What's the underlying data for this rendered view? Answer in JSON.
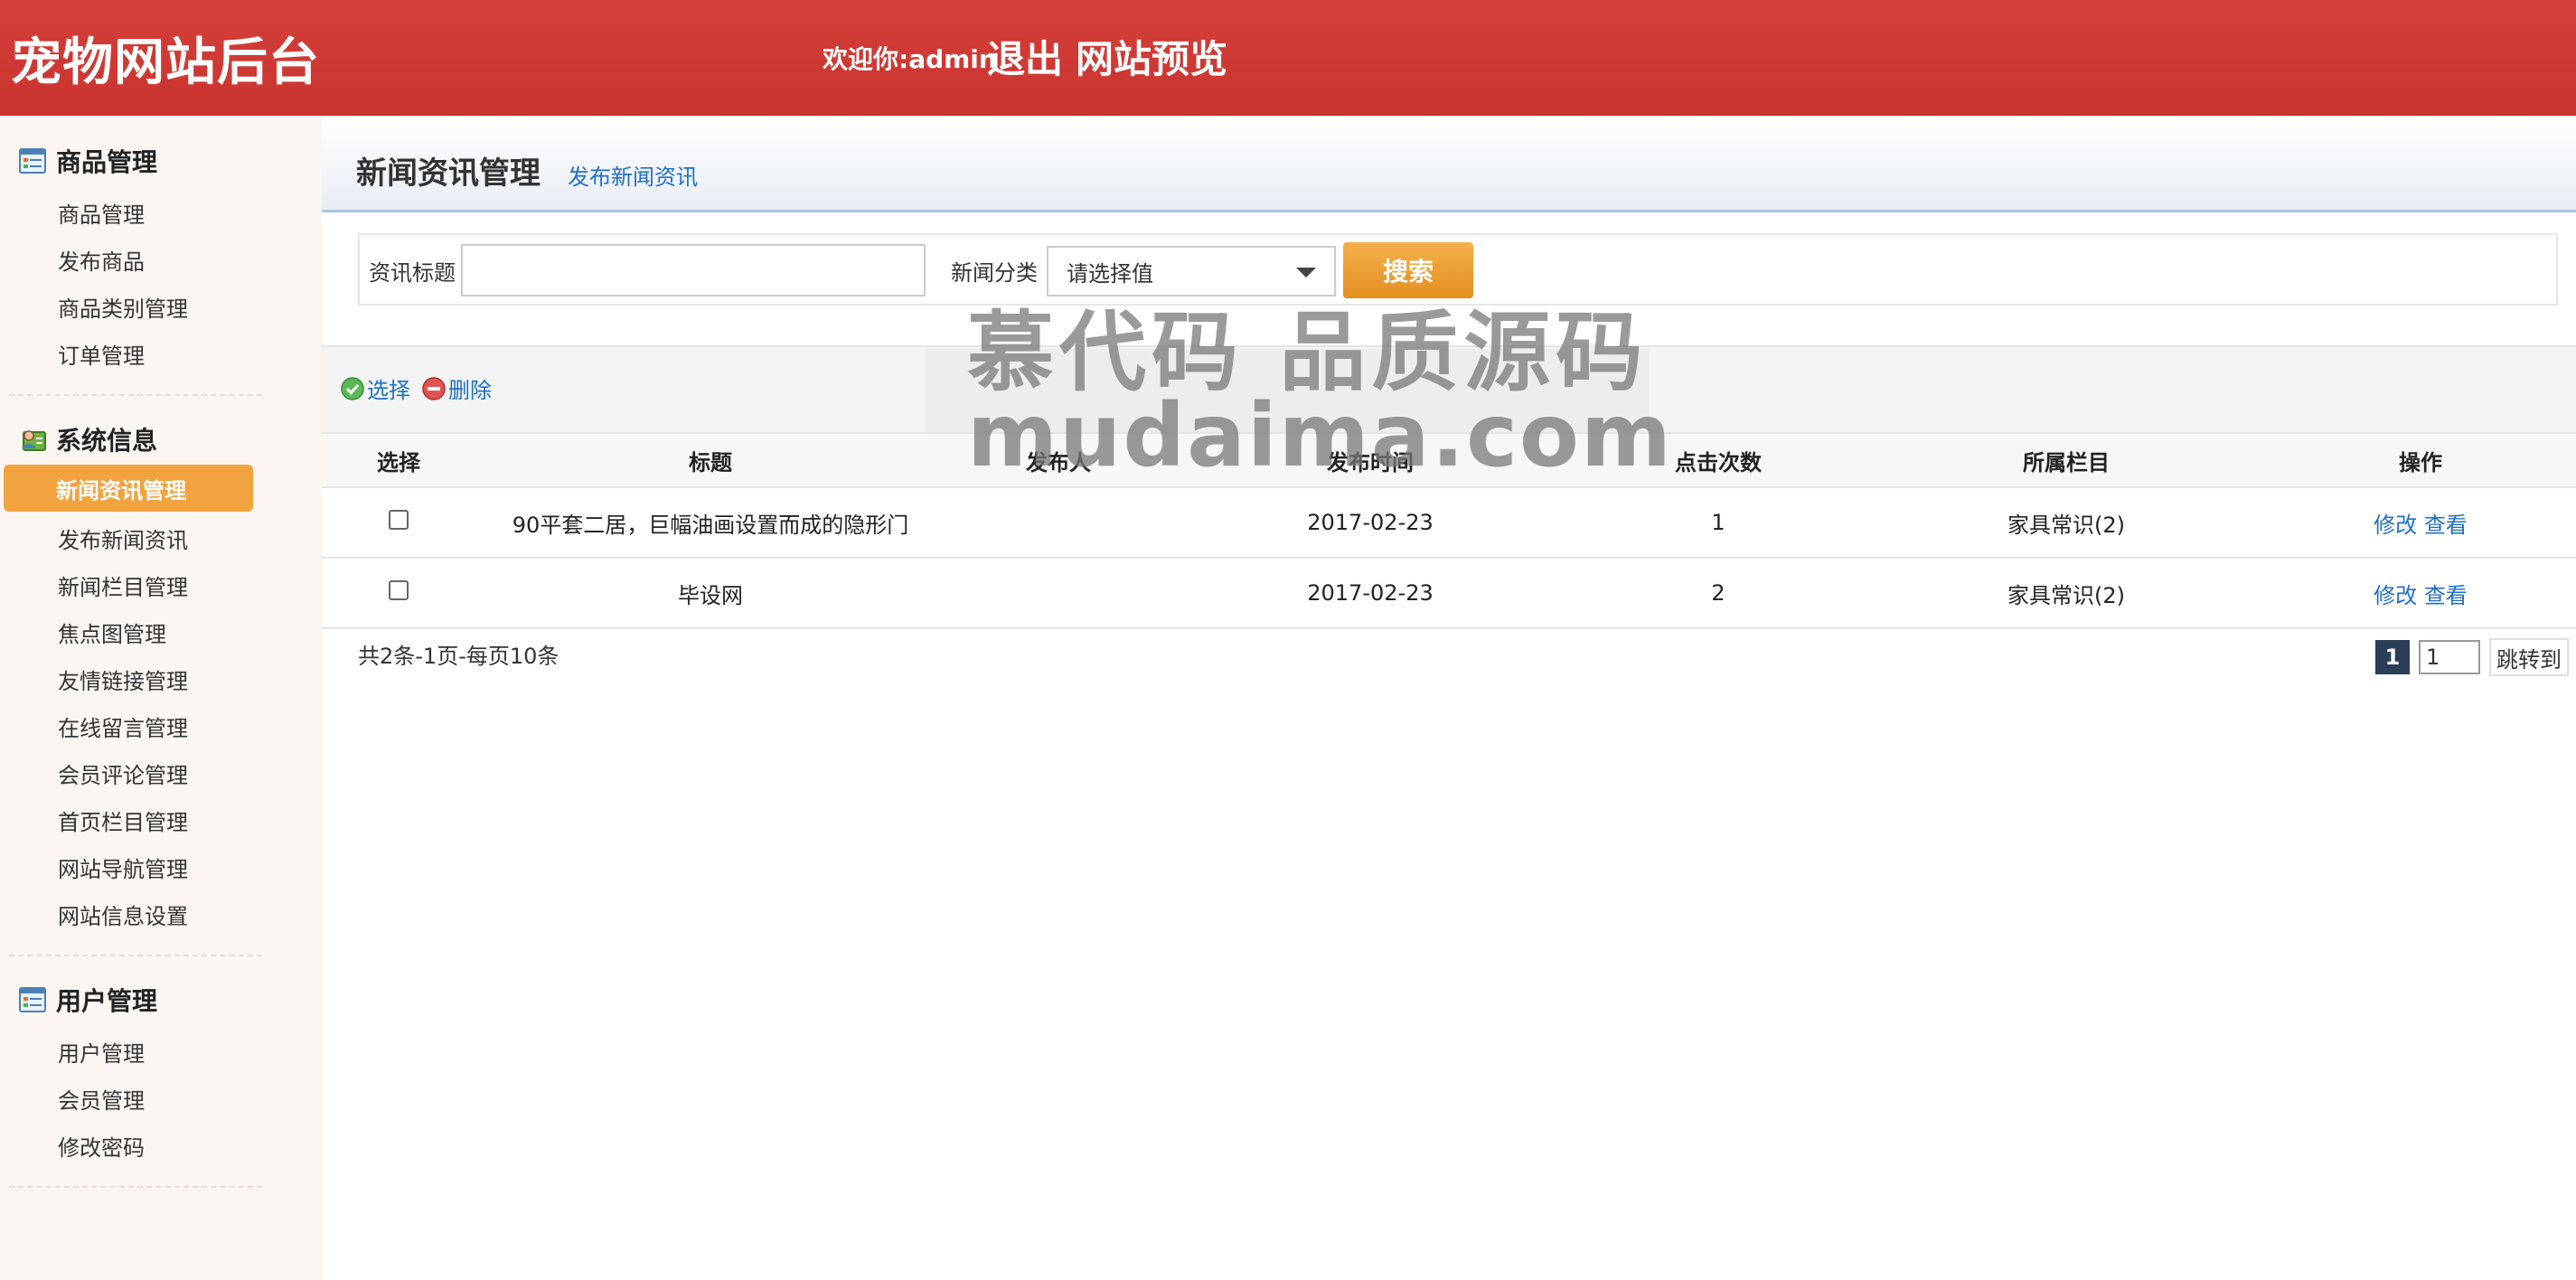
{
  "header": {
    "site_title": "宠物网站后台",
    "welcome": "欢迎你:admin",
    "logout": "退出",
    "preview": "网站预览"
  },
  "sidebar": {
    "groups": [
      {
        "title": "商品管理",
        "icon": "list-icon",
        "items": [
          "商品管理",
          "发布商品",
          "商品类别管理",
          "订单管理"
        ]
      },
      {
        "title": "系统信息",
        "icon": "user-card-icon",
        "items": [
          "新闻资讯管理",
          "发布新闻资讯",
          "新闻栏目管理",
          "焦点图管理",
          "友情链接管理",
          "在线留言管理",
          "会员评论管理",
          "首页栏目管理",
          "网站导航管理",
          "网站信息设置"
        ],
        "active_index": 0
      },
      {
        "title": "用户管理",
        "icon": "list-icon",
        "items": [
          "用户管理",
          "会员管理",
          "修改密码"
        ]
      }
    ]
  },
  "main": {
    "title": "新闻资讯管理",
    "publish_link": "发布新闻资讯",
    "search": {
      "title_label": "资讯标题",
      "title_value": "",
      "category_label": "新闻分类",
      "category_selected": "请选择值",
      "button": "搜索"
    },
    "toolbar": {
      "select": "选择",
      "delete": "删除"
    },
    "table": {
      "headers": [
        "选择",
        "标题",
        "发布人",
        "发布时间",
        "点击次数",
        "所属栏目",
        "操作"
      ],
      "rows": [
        {
          "title": "90平套二居，巨幅油画设置而成的隐形门",
          "author": "",
          "date": "2017-02-23",
          "clicks": "1",
          "column": "家具常识(2)",
          "edit": "修改",
          "view": "查看"
        },
        {
          "title": "毕设网",
          "author": "",
          "date": "2017-02-23",
          "clicks": "2",
          "column": "家具常识(2)",
          "edit": "修改",
          "view": "查看"
        }
      ]
    },
    "pager": {
      "info": "共2条-1页-每页10条",
      "current": "1",
      "input": "1",
      "goto": "跳转到"
    }
  },
  "watermark": {
    "line1": "慕代码 品质源码",
    "line2": "mudaima.com"
  },
  "colors": {
    "header": "#d43f3a",
    "active_menu": "#f1a33f",
    "link": "#1f6fc3",
    "search_button": "#e9982c"
  }
}
